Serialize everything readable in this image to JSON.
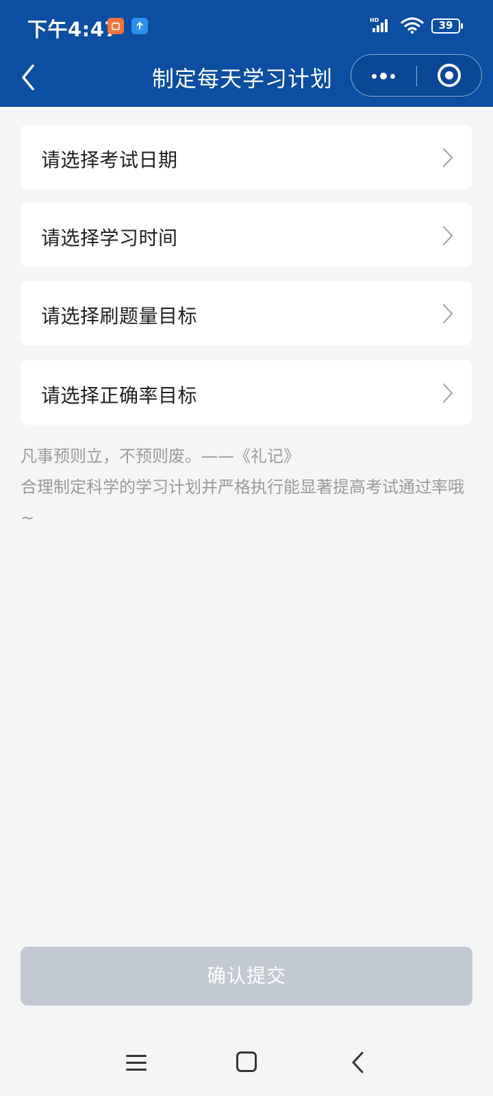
{
  "status_bar": {
    "time": "下午4:47",
    "battery": "39"
  },
  "nav": {
    "title": "制定每天学习计划"
  },
  "options": [
    {
      "label": "请选择考试日期"
    },
    {
      "label": "请选择学习时间"
    },
    {
      "label": "请选择刷题量目标"
    },
    {
      "label": "请选择正确率目标"
    }
  ],
  "quote": {
    "line1": "凡事预则立，不预则废。——《礼记》",
    "line2": "合理制定科学的学习计划并严格执行能显著提高考试通过率哦~"
  },
  "submit": {
    "label": "确认提交"
  },
  "colors": {
    "header_bg": "#0b4ea2",
    "page_bg": "#f4f5f7",
    "submit_disabled": "#c3c9d2"
  },
  "icons": {
    "back": "chevron-left-icon",
    "more": "more-dots-icon",
    "close": "target-circle-icon",
    "option_arrow": "chevron-right-icon"
  }
}
